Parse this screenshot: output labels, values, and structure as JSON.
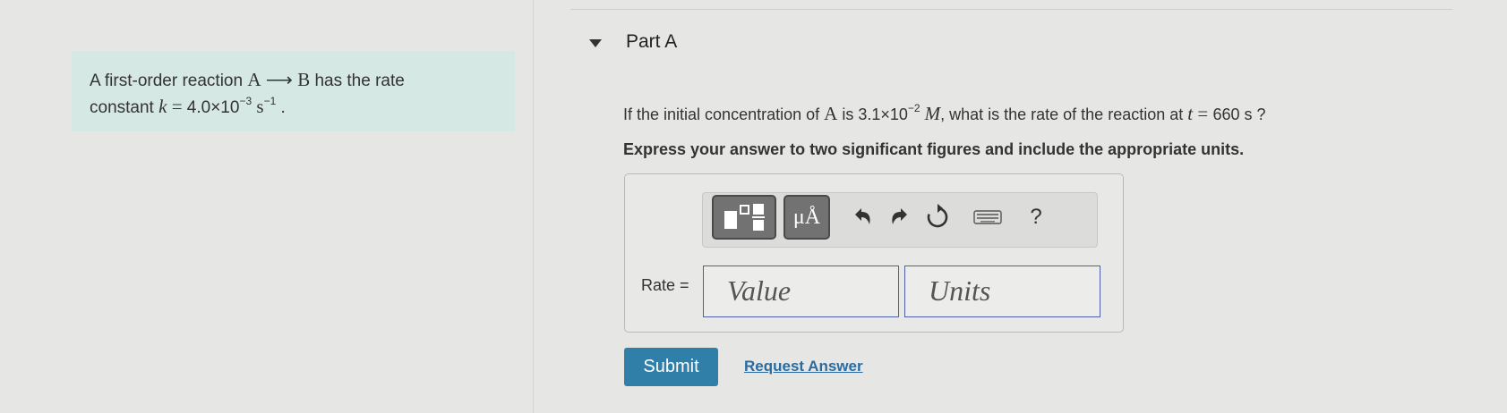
{
  "intro": {
    "line1_pre": "A first-order reaction ",
    "reactant": "A",
    "arrow": "⟶",
    "product": "B",
    "line1_post": " has the rate",
    "line2_pre": "constant ",
    "k_symbol": "k",
    "equals": " = ",
    "k_mantissa": "4.0×10",
    "k_exp": "−3",
    "k_unit": " s",
    "k_unit_exp": "−1",
    "period": " ."
  },
  "part": {
    "title": "Part A"
  },
  "question": {
    "pre": "If the initial concentration of ",
    "species": "A",
    "is": " is ",
    "conc_mantissa": "3.1×10",
    "conc_exp": "−2",
    "conc_unit": "M",
    "mid": ", what is the rate of the reaction at ",
    "t_symbol": "t",
    "t_eq": " = ",
    "t_value": "660 s",
    "end": " ?"
  },
  "instruction": "Express your answer to two significant figures and include the appropriate units.",
  "toolbar": {
    "units_label": "μÅ",
    "help_label": "?"
  },
  "answer": {
    "rate_label": "Rate =",
    "value_placeholder": "Value",
    "units_placeholder": "Units"
  },
  "actions": {
    "submit_label": "Submit",
    "request_label": "Request Answer"
  }
}
